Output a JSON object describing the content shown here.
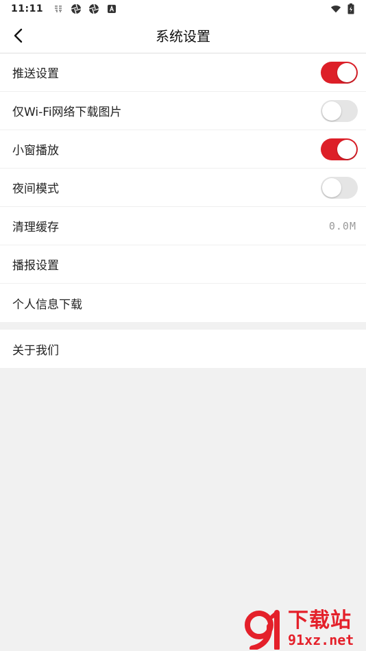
{
  "status_bar": {
    "time": "11:11"
  },
  "header": {
    "title": "系统设置"
  },
  "settings": [
    {
      "label": "推送设置",
      "toggle": "on"
    },
    {
      "label": "仅Wi-Fi网络下载图片",
      "toggle": "off"
    },
    {
      "label": "小窗播放",
      "toggle": "on"
    },
    {
      "label": "夜间模式",
      "toggle": "off"
    },
    {
      "label": "清理缓存",
      "value": "0.0M"
    },
    {
      "label": "播报设置"
    },
    {
      "label": "个人信息下载"
    }
  ],
  "about": {
    "label": "关于我们"
  },
  "watermark": {
    "brand": "下载站",
    "url": "91xz.net"
  },
  "colors": {
    "accent": "#dd1f28",
    "toggle_off": "#e5e5e5",
    "background": "#f1f1f1"
  }
}
